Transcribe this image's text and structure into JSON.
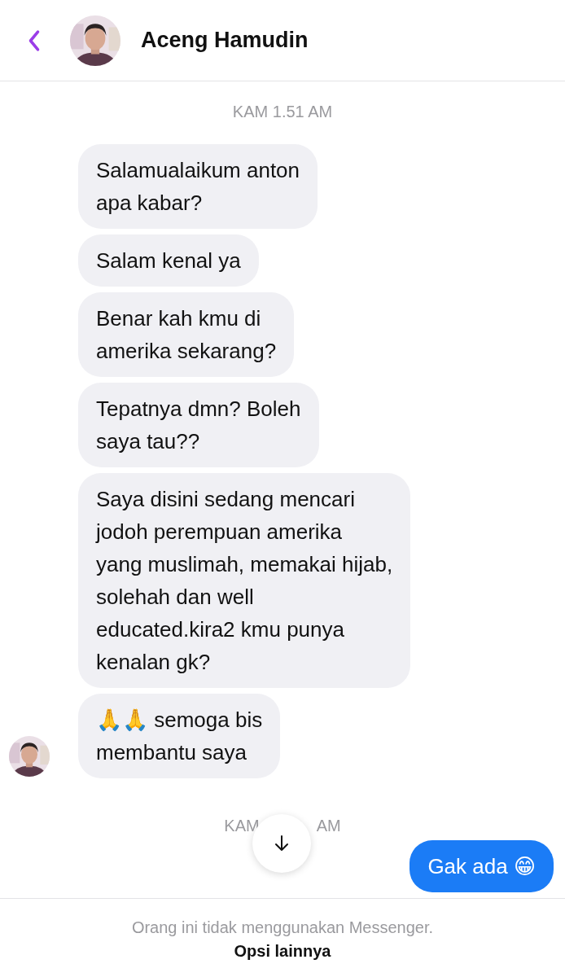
{
  "header": {
    "title": "Aceng Hamudin"
  },
  "timestamp_top": "KAM 1.51 AM",
  "received_messages": [
    {
      "text": "Salamualaikum anton\napa kabar?",
      "show_avatar": false
    },
    {
      "text": "Salam kenal ya",
      "show_avatar": false
    },
    {
      "text": "Benar kah kmu di\namerika sekarang?",
      "show_avatar": false
    },
    {
      "text": "Tepatnya dmn? Boleh\nsaya tau??",
      "show_avatar": false
    },
    {
      "text": "Saya disini sedang mencari\njodoh perempuan amerika\nyang muslimah, memakai hijab,\nsolehah dan well\neducated.kira2 kmu punya\nkenalan gk?",
      "show_avatar": false
    },
    {
      "text": "🙏🙏 semoga bis\nmembantu saya",
      "show_avatar": true
    }
  ],
  "timestamp_bottom": {
    "left": "KAM",
    "right": "AM"
  },
  "sent_messages": [
    {
      "text": "Gak ada 😁"
    }
  ],
  "footer": {
    "notice": "Orang ini tidak menggunakan Messenger.",
    "action": "Opsi lainnya"
  }
}
